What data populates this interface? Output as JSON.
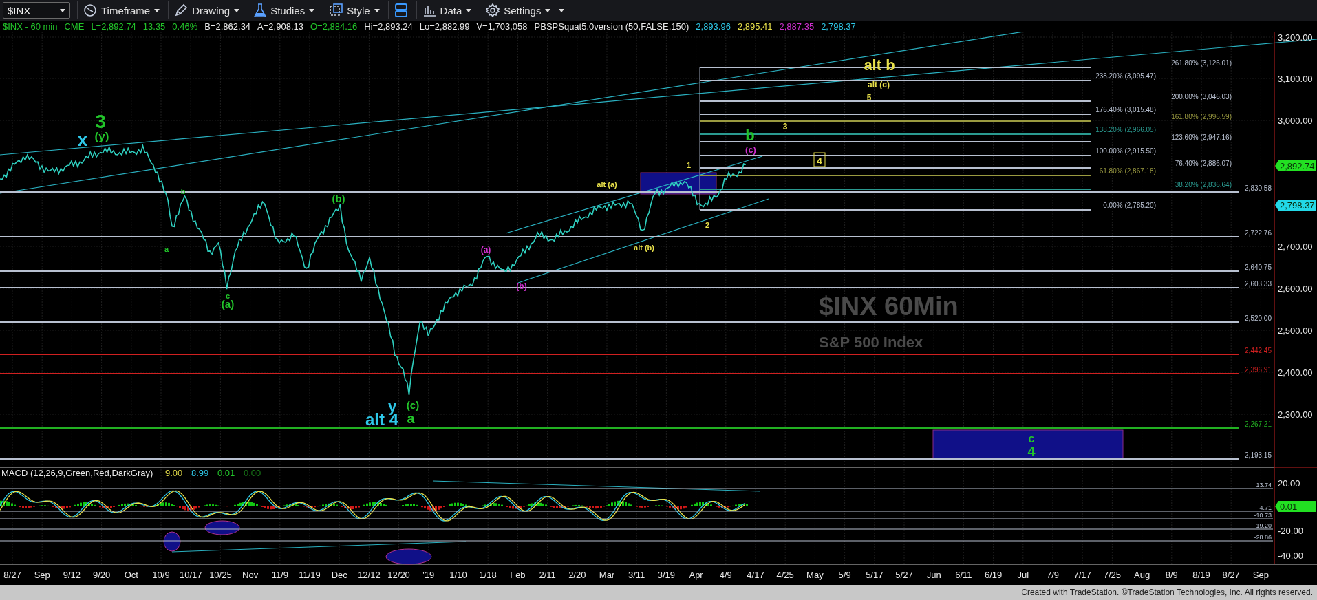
{
  "toolbar": {
    "symbol": "$INX",
    "buttons": [
      {
        "kind": "timeframe",
        "label": "Timeframe"
      },
      {
        "kind": "drawing",
        "label": "Drawing"
      },
      {
        "kind": "studies",
        "label": "Studies"
      },
      {
        "kind": "style",
        "label": "Style"
      },
      {
        "kind": "layout"
      },
      {
        "kind": "data",
        "label": "Data"
      },
      {
        "kind": "settings",
        "label": "Settings"
      }
    ]
  },
  "info_bar": [
    {
      "text": "$INX - 60 min",
      "color": "#22c42a"
    },
    {
      "text": "CME",
      "color": "#22c42a"
    },
    {
      "text": "L=2,892.74",
      "color": "#22c42a"
    },
    {
      "text": "13.35",
      "color": "#22c42a"
    },
    {
      "text": "0.46%",
      "color": "#22c42a"
    },
    {
      "text": "B=2,862.34",
      "color": "#e8e8e8"
    },
    {
      "text": "A=2,908.13",
      "color": "#e8e8e8"
    },
    {
      "text": "O=2,884.16",
      "color": "#22c42a"
    },
    {
      "text": "Hi=2,893.24",
      "color": "#e8e8e8"
    },
    {
      "text": "Lo=2,882.99",
      "color": "#e8e8e8"
    },
    {
      "text": "V=1,703,058",
      "color": "#e8e8e8"
    },
    {
      "text": "PBSPSquat5.0version (50,FALSE,150)",
      "color": "#e8e8e8"
    },
    {
      "text": "2,893.96",
      "color": "#2ec8e8"
    },
    {
      "text": "2,895.41",
      "color": "#e8e04a"
    },
    {
      "text": "2,887.35",
      "color": "#d030d0"
    },
    {
      "text": "2,798.37",
      "color": "#2ec8e8"
    }
  ],
  "chart": {
    "watermark": [
      "$INX 60Min",
      "S&P 500 Index"
    ],
    "price_axis": [
      "3,200.00",
      "3,100.00",
      "3,000.00",
      "2,700.00",
      "2,600.00",
      "2,500.00",
      "2,400.00",
      "2,300.00"
    ],
    "price_badges": [
      {
        "text": "2,892.74",
        "color": "#22e022"
      },
      {
        "text": "2,798.37",
        "color": "#22d8e8"
      }
    ],
    "fib_levels": [
      {
        "label": "261.80% (3,126.01)",
        "color": "#b8c0d0"
      },
      {
        "label": "238.20% (3,095.47)",
        "color": "#b8c0d0"
      },
      {
        "label": "200.00% (3,046.03)",
        "color": "#b8c0d0"
      },
      {
        "label": "176.40% (3,015.48)",
        "color": "#b8c0d0"
      },
      {
        "label": "161.80% (2,996.59)",
        "color": "#9a9a40"
      },
      {
        "label": "138.20% (2,966.05)",
        "color": "#2a9a90"
      },
      {
        "label": "123.60% (2,947.16)",
        "color": "#b8c0d0"
      },
      {
        "label": "100.00% (2,915.50)",
        "color": "#b8c0d0"
      },
      {
        "label": "76.40% (2,886.07)",
        "color": "#b8c0d0"
      },
      {
        "label": "61.80% (2,867.18)",
        "color": "#9a9a40"
      },
      {
        "label": "38.20% (2,836.64)",
        "color": "#2a9a90"
      },
      {
        "label": "0.00% (2,785.20)",
        "color": "#b8c0d0"
      }
    ],
    "levels": [
      {
        "label": "2,830.58",
        "color": "#b8c0d0"
      },
      {
        "label": "2,722.76",
        "color": "#b8c0d0"
      },
      {
        "label": "2,640.75",
        "color": "#b8c0d0"
      },
      {
        "label": "2,603.33",
        "color": "#b8c0d0"
      },
      {
        "label": "2,520.00",
        "color": "#b8c0d0"
      },
      {
        "label": "2,442.45",
        "color": "#d02020"
      },
      {
        "label": "2,396.91",
        "color": "#d02020"
      },
      {
        "label": "2,267.21",
        "color": "#22b022"
      },
      {
        "label": "2,193.15",
        "color": "#b8c0d0"
      }
    ],
    "wave_labels": [
      {
        "text": "x",
        "color": "#2ec8e8",
        "boxed": false
      },
      {
        "text": "3",
        "color": "#22c42a",
        "boxed": false
      },
      {
        "text": "(y)",
        "color": "#22c42a",
        "boxed": false
      },
      {
        "text": "b",
        "color": "#22c42a",
        "boxed": false
      },
      {
        "text": "a",
        "color": "#22c42a",
        "boxed": false
      },
      {
        "text": "c",
        "color": "#22c42a",
        "boxed": false
      },
      {
        "text": "(a)",
        "color": "#22c42a",
        "boxed": false
      },
      {
        "text": "(b)",
        "color": "#22c42a",
        "boxed": false
      },
      {
        "text": "y",
        "color": "#2ec8e8",
        "boxed": false
      },
      {
        "text": "alt 4",
        "color": "#2ec8e8",
        "boxed": false
      },
      {
        "text": "(c)",
        "color": "#22c42a",
        "boxed": false
      },
      {
        "text": "a",
        "color": "#22c42a",
        "boxed": false
      },
      {
        "text": "(a)",
        "color": "#d030d0",
        "boxed": false
      },
      {
        "text": "(b)",
        "color": "#d030d0",
        "boxed": false
      },
      {
        "text": "alt (a)",
        "color": "#e8e04a",
        "boxed": false
      },
      {
        "text": "alt (b)",
        "color": "#e8e04a",
        "boxed": false
      },
      {
        "text": "1",
        "color": "#e8e04a",
        "boxed": false
      },
      {
        "text": "2",
        "color": "#e8e04a",
        "boxed": false
      },
      {
        "text": "(c)",
        "color": "#d030d0",
        "boxed": false
      },
      {
        "text": "b",
        "color": "#22c42a",
        "boxed": false
      },
      {
        "text": "3",
        "color": "#e8e04a",
        "boxed": false
      },
      {
        "text": "4",
        "color": "#e8e04a",
        "boxed": true
      },
      {
        "text": "alt b",
        "color": "#e8e04a",
        "boxed": false
      },
      {
        "text": "alt (c)",
        "color": "#e8e04a",
        "boxed": false
      },
      {
        "text": "5",
        "color": "#e8e04a",
        "boxed": false
      },
      {
        "text": "c",
        "color": "#22c42a",
        "boxed": false
      },
      {
        "text": "4",
        "color": "#22c42a",
        "boxed": false
      }
    ],
    "macd": {
      "title": [
        {
          "text": "MACD (12,26,9,Green,Red,DarkGray)",
          "color": "#e8e8e8"
        },
        {
          "text": "9.00",
          "color": "#e8e04a"
        },
        {
          "text": "8.99",
          "color": "#2ec8e8"
        },
        {
          "text": "0.01",
          "color": "#22c42a"
        },
        {
          "text": "0.00",
          "color": "#187a18"
        }
      ],
      "axis": [
        "20.00",
        "-20.00",
        "-40.00"
      ],
      "levels": [
        "13.74",
        "-4.71",
        "-10.73",
        "-19.20",
        "-28.86"
      ],
      "badge": {
        "text": "0.01",
        "color": "#22e022"
      }
    },
    "time_axis": [
      "8/27",
      "Sep",
      "9/12",
      "9/20",
      "Oct",
      "10/9",
      "10/17",
      "10/25",
      "Nov",
      "11/9",
      "11/19",
      "Dec",
      "12/12",
      "12/20",
      "'19",
      "1/10",
      "1/18",
      "Feb",
      "2/11",
      "2/20",
      "Mar",
      "3/11",
      "3/19",
      "Apr",
      "4/9",
      "4/17",
      "4/25",
      "May",
      "5/9",
      "5/17",
      "5/27",
      "Jun",
      "6/11",
      "6/19",
      "Jul",
      "7/9",
      "7/17",
      "7/25",
      "Aug",
      "8/9",
      "8/19",
      "8/27",
      "Sep"
    ]
  },
  "footer": "Created with TradeStation. ©TradeStation Technologies, Inc. All rights reserved."
}
